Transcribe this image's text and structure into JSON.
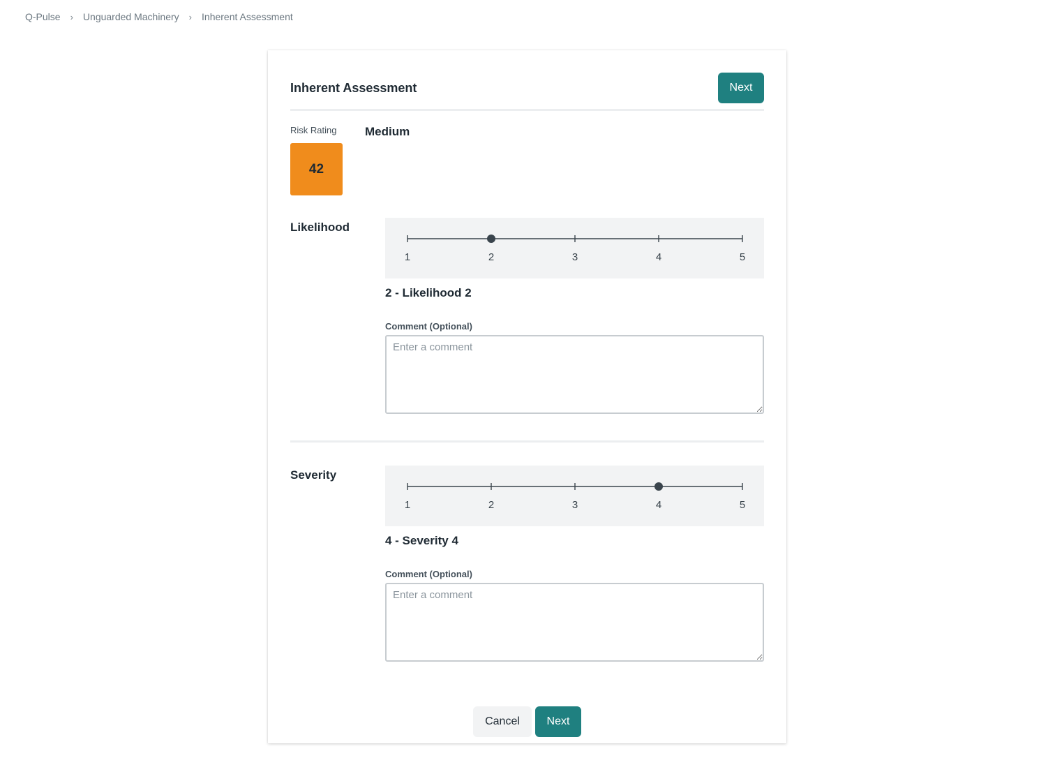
{
  "breadcrumb": {
    "items": [
      "Q-Pulse",
      "Unguarded Machinery",
      "Inherent Assessment"
    ],
    "separator": "›"
  },
  "header": {
    "title": "Inherent Assessment",
    "next_label": "Next"
  },
  "risk": {
    "label": "Risk Rating",
    "score": "42",
    "level": "Medium",
    "color": "#f08c1c"
  },
  "likelihood": {
    "label": "Likelihood",
    "scale": [
      "1",
      "2",
      "3",
      "4",
      "5"
    ],
    "selected": 2,
    "value_text": "2 - Likelihood 2",
    "comment_label": "Comment (Optional)",
    "comment_placeholder": "Enter a comment",
    "comment_value": ""
  },
  "severity": {
    "label": "Severity",
    "scale": [
      "1",
      "2",
      "3",
      "4",
      "5"
    ],
    "selected": 4,
    "value_text": "4 - Severity 4",
    "comment_label": "Comment (Optional)",
    "comment_placeholder": "Enter a comment",
    "comment_value": ""
  },
  "footer": {
    "cancel_label": "Cancel",
    "next_label": "Next"
  },
  "colors": {
    "accent": "#1f8080",
    "slider_track": "#3a444c"
  }
}
